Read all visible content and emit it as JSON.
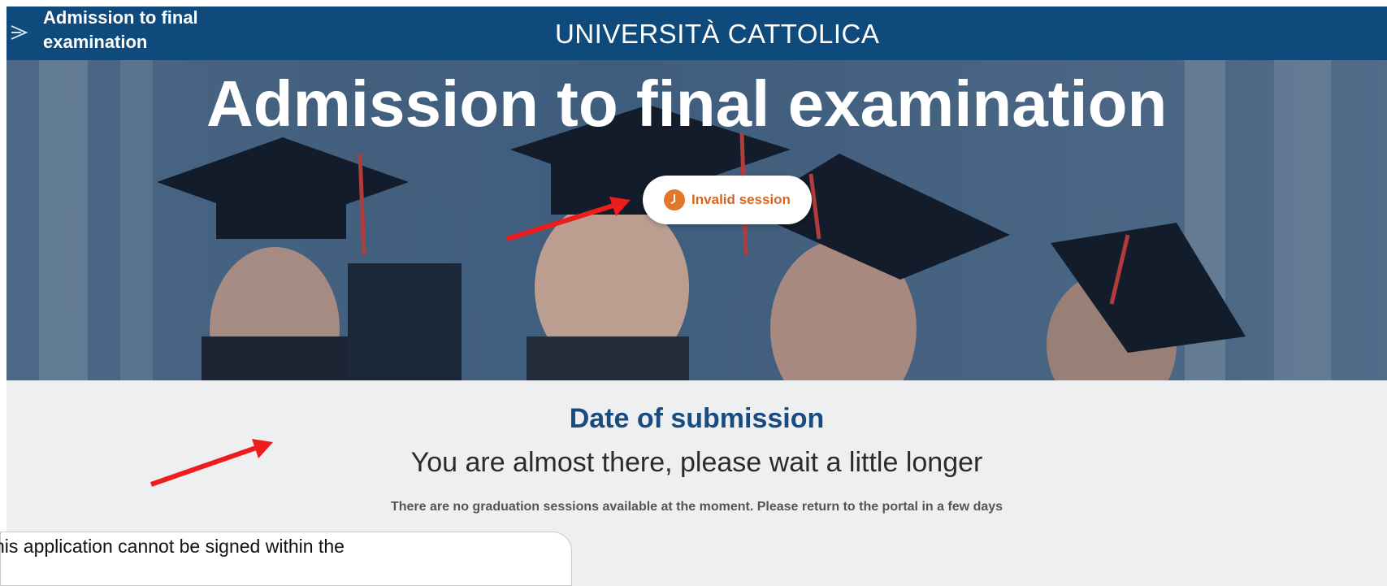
{
  "header": {
    "title_line1": "Admission to final",
    "title_line2": "examination",
    "brand": "UNIVERSITÀ CATTOLICA",
    "back_icon": "graduation-cap-icon"
  },
  "hero": {
    "title": "Admission to final examination",
    "badge_label": "Invalid session",
    "badge_icon": "clock-icon",
    "badge_color": "#e2762a"
  },
  "content": {
    "section_title": "Date of submission",
    "subtitle": "You are almost there, please wait a little longer",
    "note": "There are no graduation sessions available at the moment. Please return to the portal in a few days"
  },
  "tooltip": {
    "text": "his application cannot be signed within the"
  },
  "colors": {
    "header_bg": "#0f4a7d",
    "accent_blue": "#174c80",
    "annotation_arrow": "#ee1c1c"
  }
}
